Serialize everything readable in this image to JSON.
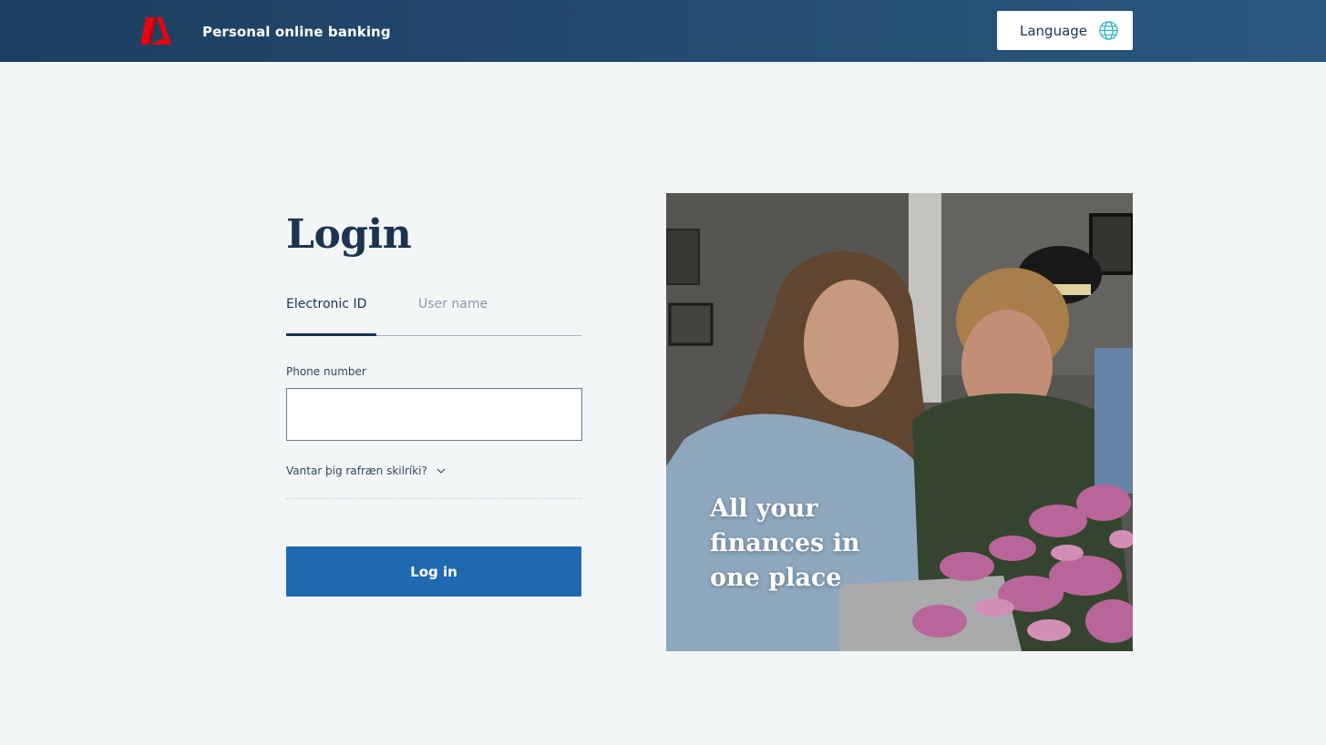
{
  "header": {
    "site_title": "Personal online banking",
    "language_label": "Language",
    "language_icon": "globe-icon",
    "logo_icon": "bank-logo",
    "brand_color": "#e30613"
  },
  "login": {
    "title": "Login",
    "tabs": [
      {
        "label": "Electronic ID",
        "active": true
      },
      {
        "label": "User name",
        "active": false
      }
    ],
    "phone_label": "Phone number",
    "phone_value": "",
    "help_text": "Vantar þig rafræn skilríki?",
    "help_icon": "chevron-down-icon",
    "submit_label": "Log in",
    "submit_color": "#1f69b1"
  },
  "hero": {
    "tagline": "All your finances in one place"
  }
}
